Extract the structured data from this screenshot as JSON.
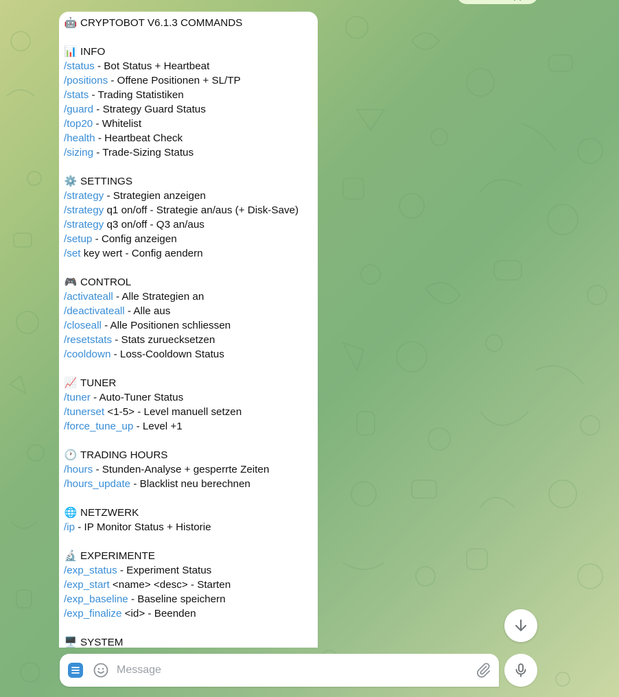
{
  "message": {
    "title_icon": "robot-emoji",
    "title": "CRYPTOBOT V6.1.3 COMMANDS",
    "sections": [
      {
        "id": "info",
        "icon": "bar-chart-emoji",
        "title": "INFO",
        "commands": [
          {
            "cmd": "/status",
            "desc": " - Bot Status + Heartbeat"
          },
          {
            "cmd": "/positions",
            "desc": " - Offene Positionen + SL/TP"
          },
          {
            "cmd": "/stats",
            "desc": " - Trading Statistiken"
          },
          {
            "cmd": "/guard",
            "desc": " - Strategy Guard Status"
          },
          {
            "cmd": "/top20",
            "desc": " - Whitelist"
          },
          {
            "cmd": "/health",
            "desc": " - Heartbeat Check"
          },
          {
            "cmd": "/sizing",
            "desc": " - Trade-Sizing Status"
          }
        ]
      },
      {
        "id": "settings",
        "icon": "gear-emoji",
        "title": "SETTINGS",
        "commands": [
          {
            "cmd": "/strategy",
            "desc": " - Strategien anzeigen"
          },
          {
            "cmd": "/strategy",
            "desc": " q1 on/off - Strategie an/aus (+ Disk-Save)"
          },
          {
            "cmd": "/strategy",
            "desc": " q3 on/off - Q3 an/aus"
          },
          {
            "cmd": "/setup",
            "desc": " - Config anzeigen"
          },
          {
            "cmd": "/set",
            "desc": " key wert - Config aendern"
          }
        ]
      },
      {
        "id": "control",
        "icon": "gamepad-emoji",
        "title": "CONTROL",
        "commands": [
          {
            "cmd": "/activateall",
            "desc": " - Alle Strategien an"
          },
          {
            "cmd": "/deactivateall",
            "desc": " - Alle aus"
          },
          {
            "cmd": "/closeall",
            "desc": " - Alle Positionen schliessen"
          },
          {
            "cmd": "/resetstats",
            "desc": " - Stats zuruecksetzen"
          },
          {
            "cmd": "/cooldown",
            "desc": " - Loss-Cooldown Status"
          }
        ]
      },
      {
        "id": "tuner",
        "icon": "trending-up-emoji",
        "title": "TUNER",
        "commands": [
          {
            "cmd": "/tuner",
            "desc": " - Auto-Tuner Status"
          },
          {
            "cmd": "/tunerset",
            "desc": " <1-5> - Level manuell setzen"
          },
          {
            "cmd": "/force_tune_up",
            "desc": " - Level +1"
          }
        ]
      },
      {
        "id": "trading-hours",
        "icon": "clock-emoji",
        "title": "TRADING HOURS",
        "commands": [
          {
            "cmd": "/hours",
            "desc": " - Stunden-Analyse + gesperrte Zeiten"
          },
          {
            "cmd": "/hours_update",
            "desc": " - Blacklist neu berechnen"
          }
        ]
      },
      {
        "id": "netzwerk",
        "icon": "globe-emoji",
        "title": "NETZWERK",
        "commands": [
          {
            "cmd": "/ip",
            "desc": " - IP Monitor Status + Historie"
          }
        ]
      },
      {
        "id": "experimente",
        "icon": "microscope-emoji",
        "title": "EXPERIMENTE",
        "commands": [
          {
            "cmd": "/exp_status",
            "desc": " - Experiment Status"
          },
          {
            "cmd": "/exp_start",
            "desc": " <name> <desc> - Starten"
          },
          {
            "cmd": "/exp_baseline",
            "desc": " - Baseline speichern"
          },
          {
            "cmd": "/exp_finalize",
            "desc": " <id> - Beenden"
          }
        ]
      },
      {
        "id": "system",
        "icon": "desktop-computer-emoji",
        "title": "SYSTEM",
        "commands": []
      }
    ]
  },
  "composer": {
    "placeholder": "Message",
    "menu_icon": "menu-icon",
    "emoji_icon": "smiley-icon",
    "attach_icon": "paperclip-icon",
    "mic_icon": "microphone-icon"
  },
  "scroll_icon": "arrow-down-icon",
  "colors": {
    "link": "#3a8ed6",
    "bubble": "#ffffff",
    "text": "#111111"
  }
}
